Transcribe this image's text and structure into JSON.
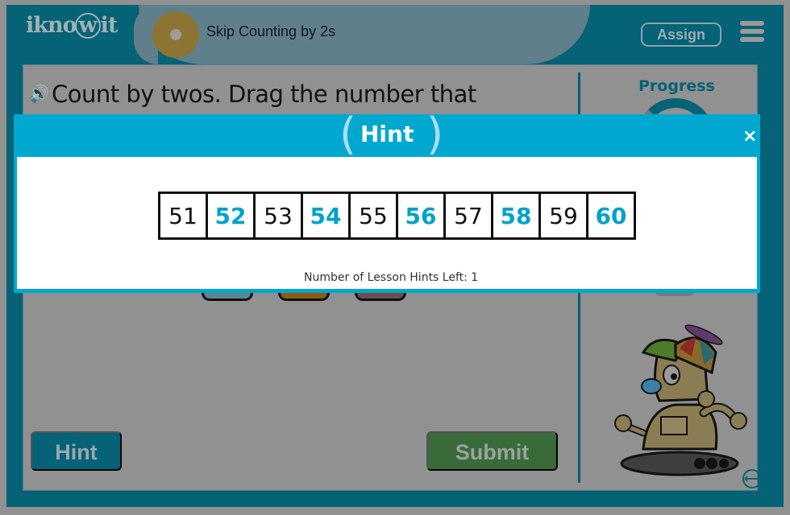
{
  "app": {
    "logo_text": "iknowit",
    "lesson_title": "Skip Counting by 2s",
    "assign_label": "Assign",
    "menu_icon": "hamburger-menu-icon"
  },
  "question": {
    "speaker_icon": "speaker-icon",
    "text": "Count by twos. Drag the number that"
  },
  "sidebar": {
    "progress_label": "Progress",
    "swap_icon": "swap-horizontal-icon"
  },
  "answer_tiles": [
    {
      "color": "#5c8591"
    },
    {
      "color": "#8e5a17"
    },
    {
      "color": "#6e4f4c"
    }
  ],
  "buttons": {
    "hint_label": "Hint",
    "submit_label": "Submit"
  },
  "hint_modal": {
    "title": "Hint",
    "close_label": "×",
    "number_line": [
      {
        "value": "51",
        "highlighted": false
      },
      {
        "value": "52",
        "highlighted": true
      },
      {
        "value": "53",
        "highlighted": false
      },
      {
        "value": "54",
        "highlighted": true
      },
      {
        "value": "55",
        "highlighted": false
      },
      {
        "value": "56",
        "highlighted": true
      },
      {
        "value": "57",
        "highlighted": false
      },
      {
        "value": "58",
        "highlighted": true
      },
      {
        "value": "59",
        "highlighted": false
      },
      {
        "value": "60",
        "highlighted": true
      }
    ],
    "hints_left_text": "Number of Lesson Hints Left: 1"
  },
  "colors": {
    "brand_teal": "#066276",
    "modal_cyan": "#00a8cf",
    "highlight": "#00a3c9",
    "submit_green": "#386b39"
  }
}
